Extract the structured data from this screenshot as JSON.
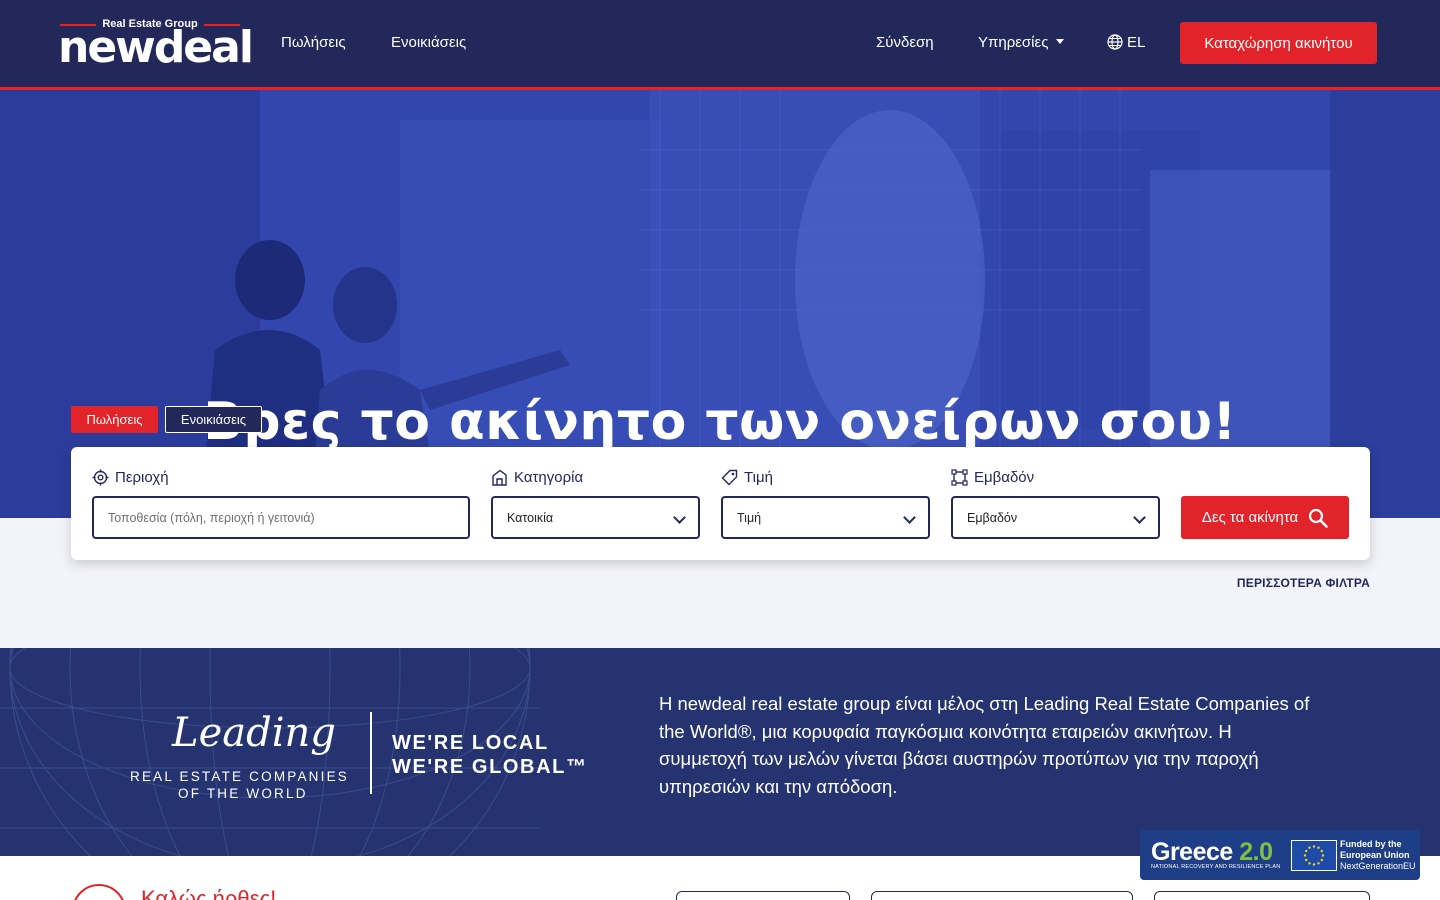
{
  "header": {
    "logo_tagline": "Real Estate Group",
    "logo_word": "newdeal",
    "nav": {
      "sales": "Πωλήσεις",
      "rentals": "Ενοικιάσεις"
    },
    "login": "Σύνδεση",
    "services": "Υπηρεσίες",
    "language": "EL",
    "list_property": "Καταχώρηση ακινήτου"
  },
  "hero": {
    "title": "Βρες το ακίνητο των ονείρων σου!",
    "tabs": {
      "sales": "Πωλήσεις",
      "rentals": "Ενοικιάσεις"
    }
  },
  "search": {
    "area_label": "Περιοχή",
    "area_placeholder": "Τοποθεσία (πόλη, περιοχή ή γειτονιά)",
    "category_label": "Κατηγορία",
    "category_value": "Κατοικία",
    "price_label": "Τιμή",
    "price_value": "Τιμή",
    "size_label": "Εμβαδόν",
    "size_value": "Εμβαδόν",
    "submit": "Δες τα ακίνητα",
    "more_filters": "ΠΕΡΙΣΣΟΤΕΡΑ ΦΙΛΤΡΑ"
  },
  "leading": {
    "script": "Leading",
    "sub1": "REAL ESTATE COMPANIES",
    "sub2": "OF THE WORLD",
    "local1": "WE'RE LOCAL",
    "local2": "WE'RE GLOBAL™",
    "text": "Η newdeal real estate group είναι μέλος στη Leading Real Estate Companies of the World®, μια κορυφαία παγκόσμια κοινότητα εταιρειών ακινήτων. Η συμμετοχή των μελών γίνεται βάσει αυστηρών προτύπων για την παροχή υπηρεσιών και την απόδοση."
  },
  "bottom": {
    "welcome": "Καλώς ήρθες!"
  },
  "eu_badge": {
    "greece": "Greece",
    "version": "2.0",
    "sub": "NATIONAL RECOVERY AND RESILIENCE PLAN",
    "funded1": "Funded by the",
    "funded2": "European Union",
    "funded3": "NextGenerationEU"
  },
  "colors": {
    "navy": "#22295a",
    "red": "#e2232a",
    "band": "#253470",
    "hero_blue": "#3348b0"
  }
}
